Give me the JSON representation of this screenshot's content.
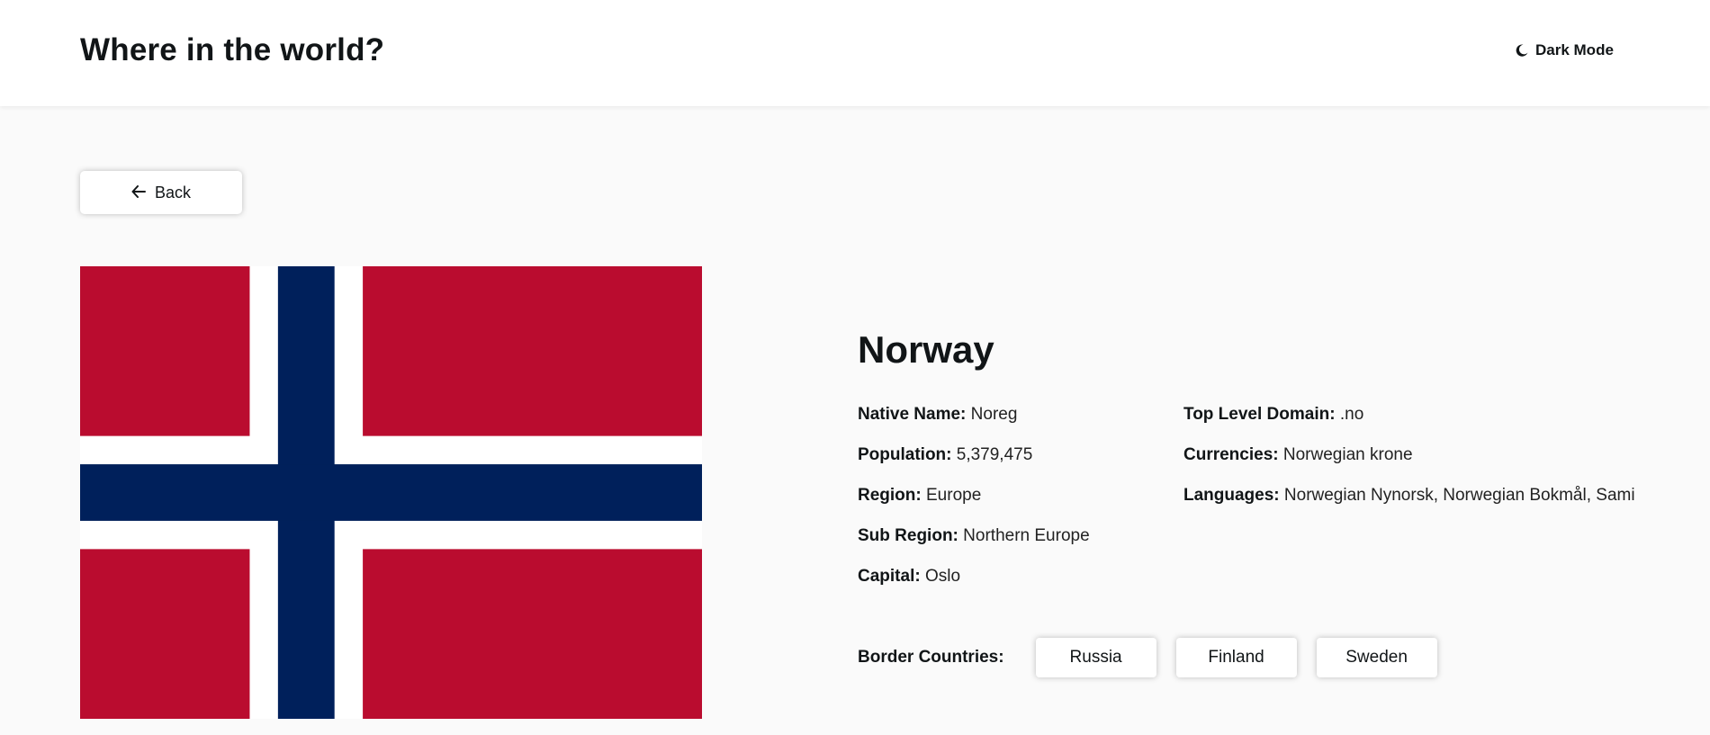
{
  "header": {
    "title": "Where in the world?",
    "dark_mode_label": "Dark Mode",
    "dark_mode_icon": "moon-icon"
  },
  "back_button": {
    "label": "Back",
    "icon": "arrow-left-icon"
  },
  "country": {
    "name": "Norway",
    "flag": {
      "icon": "norway-flag",
      "colors": {
        "red": "#ba0c2f",
        "white": "#ffffff",
        "blue": "#00205b"
      }
    },
    "left_fields": [
      {
        "label": "Native Name:",
        "value": "Noreg"
      },
      {
        "label": "Population:",
        "value": "5,379,475"
      },
      {
        "label": "Region:",
        "value": "Europe"
      },
      {
        "label": "Sub Region:",
        "value": "Northern Europe"
      },
      {
        "label": "Capital:",
        "value": "Oslo"
      }
    ],
    "right_fields": [
      {
        "label": "Top Level Domain:",
        "value": ".no"
      },
      {
        "label": "Currencies:",
        "value": "Norwegian krone"
      },
      {
        "label": "Languages:",
        "value": "Norwegian Nynorsk, Norwegian Bokmål, Sami"
      }
    ],
    "border_label": "Border Countries:",
    "border_countries": [
      "Russia",
      "Finland",
      "Sweden"
    ]
  }
}
